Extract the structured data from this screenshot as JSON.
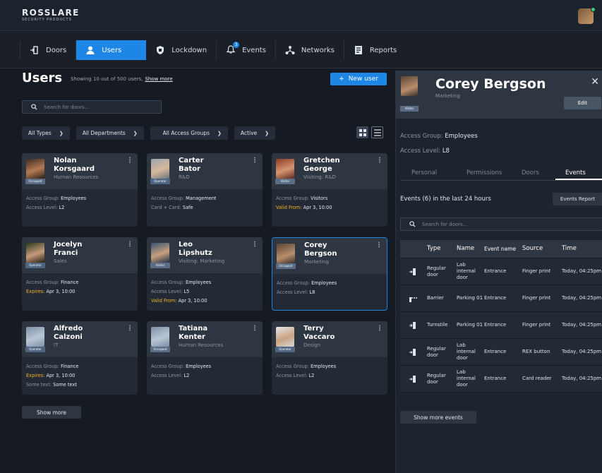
{
  "app": {
    "brand": "ROSSLARE",
    "brand_sub": "SECURITY PRODUCTS",
    "brand_color": "#1d86e6"
  },
  "nav": {
    "tabs": [
      {
        "label": "Doors",
        "icon": "door-icon"
      },
      {
        "label": "Users",
        "icon": "user-icon",
        "active": true
      },
      {
        "label": "Lockdown",
        "icon": "shield-icon"
      },
      {
        "label": "Events",
        "icon": "bell-icon",
        "badge": "3"
      },
      {
        "label": "Networks",
        "icon": "network-icon"
      },
      {
        "label": "Reports",
        "icon": "report-icon"
      }
    ]
  },
  "users_page": {
    "title": "Users",
    "showing": "Showing 10 out of 500 users,",
    "show_more_link": "Show more",
    "new_user_label": "New user",
    "search_placeholder": "Search for doors...",
    "filters": [
      "All Types",
      "All Departments",
      "All Access Groups",
      "Active"
    ],
    "show_more_button": "Show more"
  },
  "cards": [
    {
      "first": "Nolan",
      "last": "Korsgaard",
      "dept": "Human Resources",
      "tag": "Occupant",
      "l1k": "Access Group:",
      "l1v": "Employees",
      "l2k": "Access Level:",
      "l2v": "L2",
      "l3k": "",
      "l3v": ""
    },
    {
      "first": "Carter",
      "last": "Bator",
      "dept": "R&D",
      "tag": "Operator",
      "l1k": "Access Group:",
      "l1v": "Management",
      "l2k": "Card + Card:",
      "l2v": "Safe",
      "l3k": "",
      "l3v": ""
    },
    {
      "first": "Gretchen",
      "last": "George",
      "dept": "Visiting: R&D",
      "tag": "Visitor",
      "l1k": "Access Group:",
      "l1v": "Visitors",
      "l2k": "Valid From:",
      "l2v": "Apr 3, 10:00",
      "l3k": "",
      "l3v": ""
    },
    {
      "first": "Jocelyn",
      "last": "Franci",
      "dept": "Sales",
      "tag": "Operator",
      "l1k": "Access Group:",
      "l1v": "Finance",
      "l2k": "Expires:",
      "l2v": "Apr 3, 10:00",
      "l3k": "",
      "l3v": ""
    },
    {
      "first": "Leo",
      "last": "Lipshutz",
      "dept": "Visiting: Marketing",
      "tag": "Visitor",
      "l1k": "Access Group:",
      "l1v": "Employees",
      "l2k": "Access Level:",
      "l2v": "L5",
      "l3k": "Valid From:",
      "l3v": "Apr 3, 10:00"
    },
    {
      "first": "Corey",
      "last": "Bergson",
      "dept": "Marketing",
      "tag": "Occupant",
      "l1k": "Access Group:",
      "l1v": "Employees",
      "l2k": "Access Level:",
      "l2v": "L8",
      "l3k": "",
      "l3v": ""
    },
    {
      "first": "Alfredo",
      "last": "Calzoni",
      "dept": "IT",
      "tag": "Operator",
      "l1k": "Access Group:",
      "l1v": "Finance",
      "l2k": "Expires:",
      "l2v": "Apr 3, 10:00",
      "l3k": "Some text:",
      "l3v": "Some text"
    },
    {
      "first": "Tatiana",
      "last": "Kenter",
      "dept": "Human Resources",
      "tag": "Occupant",
      "l1k": "Access Group:",
      "l1v": "Employees",
      "l2k": "Access Level:",
      "l2v": "L2",
      "l3k": "",
      "l3v": ""
    },
    {
      "first": "Terry",
      "last": "Vaccaro",
      "dept": "Design",
      "tag": "Operator",
      "l1k": "Access Group:",
      "l1v": "Employees",
      "l2k": "Access Level:",
      "l2v": "L2",
      "l3k": "",
      "l3v": ""
    }
  ],
  "panel": {
    "name": "Corey Bergson",
    "dept": "Marketing",
    "tag": "Visitor",
    "edit_label": "Edit",
    "access_group_key": "Access Group:",
    "access_group_val": "Employees",
    "access_level_key": "Access Level:",
    "access_level_val": "L8",
    "tabs": [
      "Personal",
      "Permissions",
      "Doors",
      "Events"
    ],
    "events_title": "Events (6) in the last 24 hours",
    "events_report": "Events Report",
    "search_placeholder": "Search for doors...",
    "columns": [
      "Type",
      "Name",
      "Event name",
      "Source",
      "Time"
    ],
    "events": [
      {
        "icon": "door-icon",
        "type": "Regular door",
        "name": "Lab internal door",
        "event": "Entrance",
        "source": "Finger print",
        "time": "Today, 04:25pm"
      },
      {
        "icon": "barrier-icon",
        "type": "Barrier",
        "name": "Parking 01",
        "event": "Entrance",
        "source": "Finger print",
        "time": "Today, 04:25pm"
      },
      {
        "icon": "turnstile-icon",
        "type": "Turnstile",
        "name": "Parking 01",
        "event": "Entrance",
        "source": "Finger print",
        "time": "Today, 04:25pm"
      },
      {
        "icon": "door-icon",
        "type": "Regular door",
        "name": "Lab internal door",
        "event": "Entrance",
        "source": "REX button",
        "time": "Today, 04:25pm"
      },
      {
        "icon": "door-icon",
        "type": "Regular door",
        "name": "Lab internal door",
        "event": "Entrance",
        "source": "Card reader",
        "time": "Today, 04:25pm"
      }
    ],
    "show_more_events": "Show more events"
  }
}
